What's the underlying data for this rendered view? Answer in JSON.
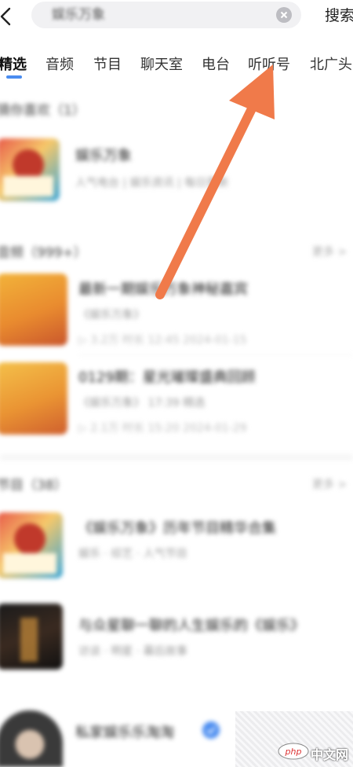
{
  "header": {
    "search_placeholder": "娱乐万象",
    "search_button": "搜索"
  },
  "tabs": [
    {
      "label": "精选",
      "active": true
    },
    {
      "label": "音频"
    },
    {
      "label": "节目"
    },
    {
      "label": "聊天室"
    },
    {
      "label": "电台"
    },
    {
      "label": "听听号"
    },
    {
      "label": "北广头"
    }
  ],
  "sections": {
    "top": {
      "title": "猜你喜欢（1）",
      "item_title": "娱乐万象",
      "item_sub": "人气电台 | 娱乐资讯 | 每日更新"
    },
    "audio": {
      "title": "音频（999+）",
      "more": "更多 >",
      "items": [
        {
          "title": "最新一期娱乐万象神秘嘉宾",
          "sub": "《娱乐万象》",
          "meta": "▷ 3.2万  时长 12:45  2024-01-15"
        },
        {
          "title": "0129期：星光璀璨盛典回顾",
          "sub": "《娱乐万象》 17:39 精选",
          "meta": "▷ 2.1万  时长 15:20  2024-01-29"
        }
      ]
    },
    "programs": {
      "title": "节目（38）",
      "more": "更多 >",
      "items": [
        {
          "title": "《娱乐万象》历年节目精华合集",
          "sub": "娱乐 · 综艺 · 人气节目"
        },
        {
          "title": "与众星聊一聊的人生娱乐的《娱乐》",
          "sub": "访谈 · 明星 · 幕后故事"
        }
      ]
    },
    "host": {
      "name": "私家娱乐乐淘淘"
    }
  },
  "watermark": {
    "logo": "php",
    "text": "中文网"
  },
  "colors": {
    "arrow": "#f07a4a",
    "tab_indicator": "#4a8cf0",
    "search_bg": "#f1f1f3"
  }
}
